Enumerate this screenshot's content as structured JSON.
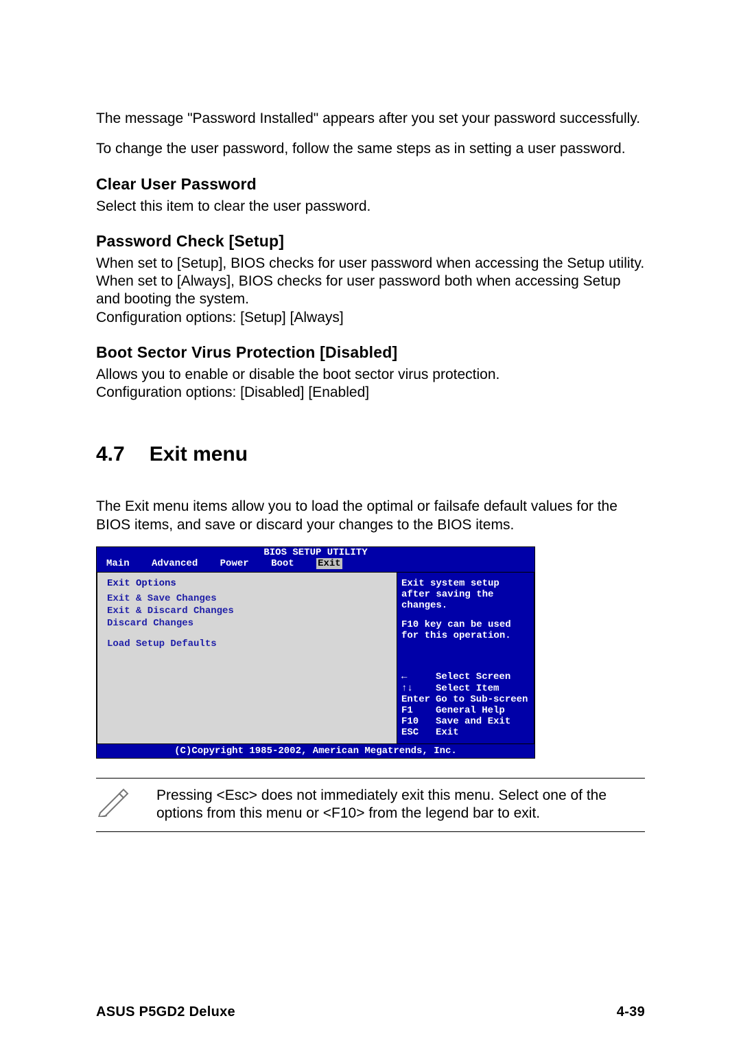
{
  "intro1": "The message \"Password Installed\" appears after you set your password successfully.",
  "intro2": "To change the user password, follow the same steps as in setting a user password.",
  "clear": {
    "heading": "Clear User Password",
    "body": "Select this item to clear the user password."
  },
  "pcheck": {
    "heading": "Password Check [Setup]",
    "body1": "When set to [Setup], BIOS checks for user password when accessing the Setup utility. When set to [Always], BIOS checks for user password both when accessing Setup and booting the system.",
    "body2": "Configuration options: [Setup] [Always]"
  },
  "bootsec": {
    "heading": "Boot Sector Virus Protection [Disabled]",
    "body1": "Allows you to enable or disable the boot sector virus protection.",
    "body2": "Configuration options: [Disabled] [Enabled]"
  },
  "section": {
    "num": "4.7",
    "title": "Exit menu"
  },
  "exit_intro": "The Exit menu items allow you to load the optimal or failsafe default values for the BIOS items, and save or discard your changes to the BIOS items.",
  "bios": {
    "title": "BIOS SETUP UTILITY",
    "tabs": [
      "Main",
      "Advanced",
      "Power",
      "Boot",
      "Exit"
    ],
    "active_tab": "Exit",
    "left_header": "Exit Options",
    "items": [
      "Exit & Save Changes",
      "Exit & Discard Changes",
      "Discard Changes",
      "Load Setup Defaults"
    ],
    "help1": "Exit system setup after saving the changes.",
    "help2": "F10 key can be used for this operation.",
    "legend": [
      {
        "key": "←",
        "label": "Select Screen"
      },
      {
        "key": "↑↓",
        "label": "Select Item"
      },
      {
        "key": "Enter",
        "label": "Go to Sub-screen"
      },
      {
        "key": "F1",
        "label": "General Help"
      },
      {
        "key": "F10",
        "label": "Save and Exit"
      },
      {
        "key": "ESC",
        "label": "Exit"
      }
    ],
    "copyright": "(C)Copyright 1985-2002, American Megatrends, Inc."
  },
  "note": "Pressing <Esc> does not immediately exit this menu. Select one of the options from this menu or <F10> from the legend bar to exit.",
  "footer": {
    "left": "ASUS P5GD2 Deluxe",
    "right": "4-39"
  }
}
